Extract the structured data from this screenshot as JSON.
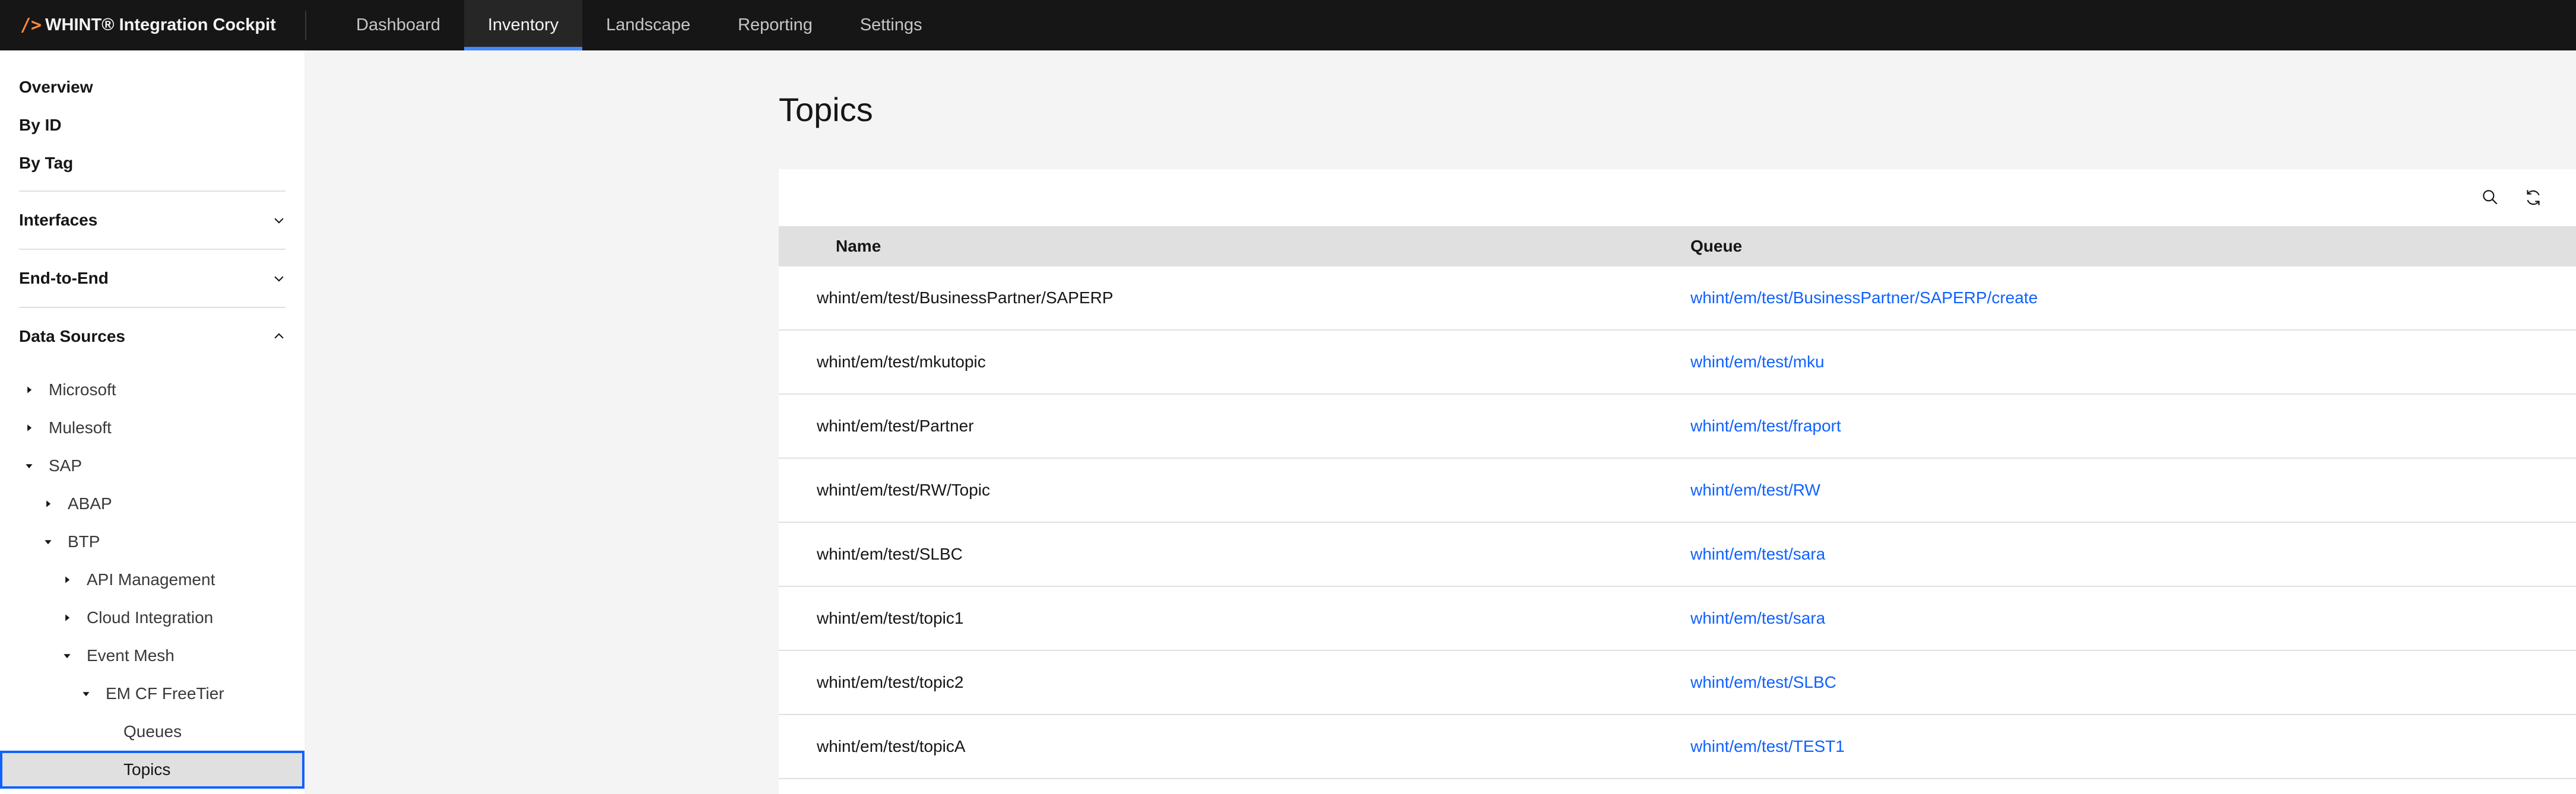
{
  "app": {
    "brand_mark": "/>",
    "brand_name": "WHINT® Integration Cockpit"
  },
  "nav": [
    {
      "label": "Dashboard",
      "active": false
    },
    {
      "label": "Inventory",
      "active": true
    },
    {
      "label": "Landscape",
      "active": false
    },
    {
      "label": "Reporting",
      "active": false
    },
    {
      "label": "Settings",
      "active": false
    }
  ],
  "sidebar": {
    "links": [
      "Overview",
      "By ID",
      "By Tag"
    ],
    "sections": [
      {
        "label": "Interfaces",
        "expanded": false,
        "icon": "chevron-down-icon"
      },
      {
        "label": "End-to-End",
        "expanded": false,
        "icon": "chevron-down-icon"
      },
      {
        "label": "Data Sources",
        "expanded": true,
        "icon": "chevron-up-icon"
      }
    ],
    "tree": [
      {
        "label": "Microsoft",
        "level": 0,
        "state": "collapsed"
      },
      {
        "label": "Mulesoft",
        "level": 0,
        "state": "collapsed"
      },
      {
        "label": "SAP",
        "level": 0,
        "state": "expanded"
      },
      {
        "label": "ABAP",
        "level": 1,
        "state": "collapsed"
      },
      {
        "label": "BTP",
        "level": 1,
        "state": "expanded"
      },
      {
        "label": "API Management",
        "level": 2,
        "state": "collapsed"
      },
      {
        "label": "Cloud Integration",
        "level": 2,
        "state": "collapsed"
      },
      {
        "label": "Event Mesh",
        "level": 2,
        "state": "expanded"
      },
      {
        "label": "EM CF FreeTier",
        "level": 3,
        "state": "expanded"
      },
      {
        "label": "Queues",
        "level": 4,
        "state": "leaf"
      },
      {
        "label": "Topics",
        "level": 4,
        "state": "leaf",
        "selected": true
      }
    ]
  },
  "main": {
    "title": "Topics",
    "toolbar": {
      "search_icon": "search-icon",
      "refresh_icon": "refresh-icon"
    },
    "columns": [
      "Name",
      "Queue"
    ],
    "rows": [
      {
        "name": "whint/em/test/BusinessPartner/SAPERP",
        "queue": "whint/em/test/BusinessPartner/SAPERP/create"
      },
      {
        "name": "whint/em/test/mkutopic",
        "queue": "whint/em/test/mku"
      },
      {
        "name": "whint/em/test/Partner",
        "queue": "whint/em/test/fraport"
      },
      {
        "name": "whint/em/test/RW/Topic",
        "queue": "whint/em/test/RW"
      },
      {
        "name": "whint/em/test/SLBC",
        "queue": "whint/em/test/sara"
      },
      {
        "name": "whint/em/test/topic1",
        "queue": "whint/em/test/sara"
      },
      {
        "name": "whint/em/test/topic2",
        "queue": "whint/em/test/SLBC"
      },
      {
        "name": "whint/em/test/topicA",
        "queue": "whint/em/test/TEST1"
      }
    ]
  },
  "colors": {
    "header_bg": "#161616",
    "accent": "#0f62fe",
    "active_tab_underline": "#4589ff",
    "brand_mark": "#ff8a3d"
  }
}
